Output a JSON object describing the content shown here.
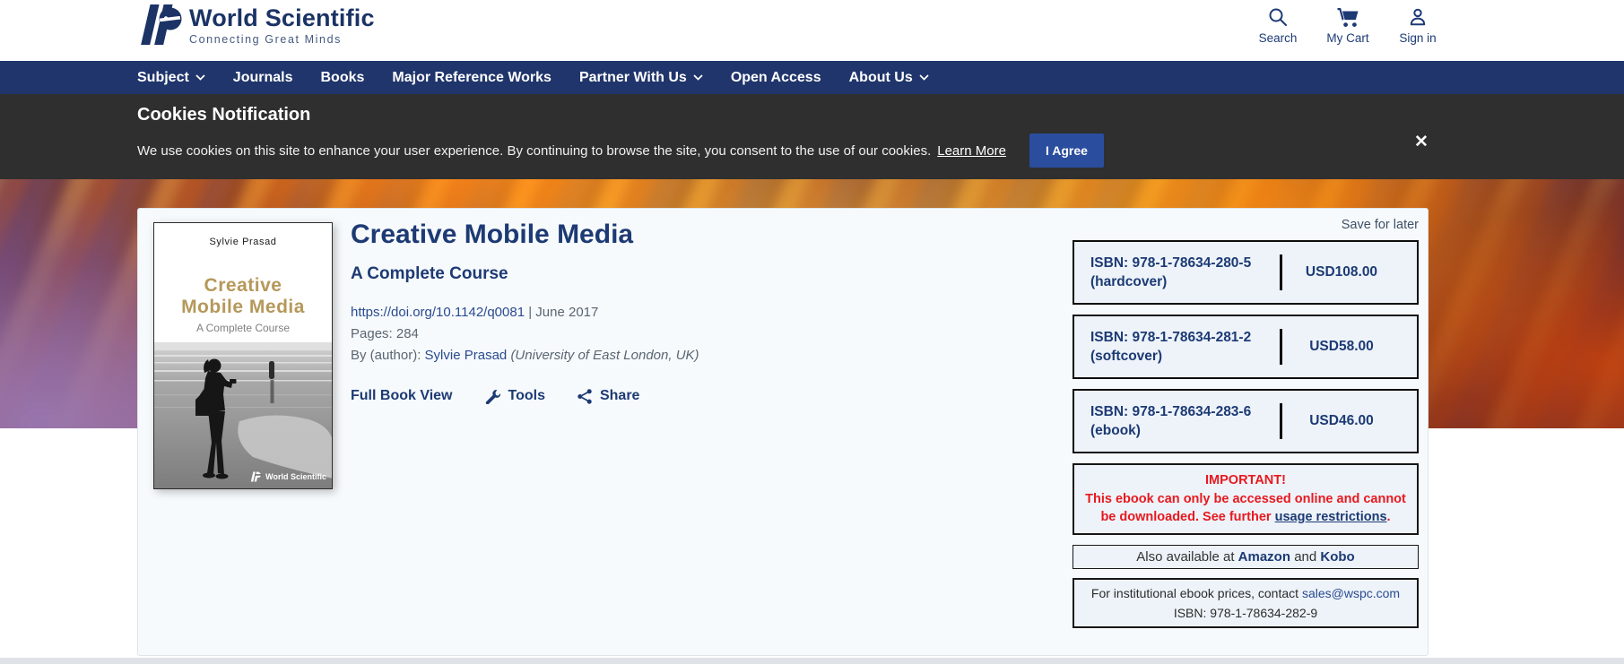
{
  "colors": {
    "navy": "#1d3a74",
    "nav-bg": "#20356b",
    "banner-bg": "#2f2f2f",
    "agree-bg": "#2a4d9e",
    "alert-red": "#e8191f",
    "link-blue": "#2a4b8f",
    "card-bg": "#f7fafc",
    "box-bg": "#edf3f9",
    "gray-text": "#5a6672",
    "gold": "#b5985a"
  },
  "header": {
    "brand": "World Scientific",
    "tagline": "Connecting Great Minds",
    "actions": [
      {
        "label": "Search",
        "icon": "search-icon"
      },
      {
        "label": "My Cart",
        "icon": "cart-icon"
      },
      {
        "label": "Sign in",
        "icon": "user-icon"
      }
    ]
  },
  "nav": {
    "items": [
      {
        "label": "Subject",
        "has_dropdown": true
      },
      {
        "label": "Journals",
        "has_dropdown": false
      },
      {
        "label": "Books",
        "has_dropdown": false
      },
      {
        "label": "Major Reference Works",
        "has_dropdown": false
      },
      {
        "label": "Partner With Us",
        "has_dropdown": true
      },
      {
        "label": "Open Access",
        "has_dropdown": false
      },
      {
        "label": "About Us",
        "has_dropdown": true
      }
    ]
  },
  "cookie_banner": {
    "title": "Cookies Notification",
    "message": "We use cookies on this site to enhance your user experience. By continuing to browse the site, you consent to the use of our cookies.",
    "learn_more": "Learn More",
    "agree_label": "I Agree",
    "close_icon": "✕"
  },
  "book": {
    "title": "Creative Mobile Media",
    "subtitle": "A Complete Course",
    "doi": "https://doi.org/10.1142/q0081",
    "separator": "|",
    "date": "June 2017",
    "pages": "Pages: 284",
    "by_label": "By (author):",
    "author": "Sylvie Prasad",
    "affiliation": "(University of East London, UK)",
    "cover": {
      "author": "Sylvie Prasad",
      "title_line1": "Creative",
      "title_line2": "Mobile Media",
      "subtitle": "A Complete Course",
      "publisher": "World Scientific"
    }
  },
  "actions_row": {
    "full_book_view": "Full Book View",
    "tools": "Tools",
    "share": "Share"
  },
  "purchase": {
    "save_for_later": "Save for later",
    "offers": [
      {
        "isbn": "ISBN: 978-1-78634-280-5",
        "format": "(hardcover)",
        "price": "USD108.00"
      },
      {
        "isbn": "ISBN: 978-1-78634-281-2",
        "format": "(softcover)",
        "price": "USD58.00"
      },
      {
        "isbn": "ISBN: 978-1-78634-283-6",
        "format": "(ebook)",
        "price": "USD46.00"
      }
    ],
    "important": {
      "title": "IMPORTANT!",
      "message": "This ebook can only be accessed online and cannot be downloaded. See further",
      "link": "usage restrictions",
      "suffix": "."
    },
    "also_available": {
      "prefix": "Also available at",
      "amazon": "Amazon",
      "conjunction": "and",
      "kobo": "Kobo"
    },
    "institutional": {
      "prefix": "For institutional ebook prices, contact",
      "email": "sales@wspc.com",
      "isbn": "ISBN: 978-1-78634-282-9"
    }
  }
}
